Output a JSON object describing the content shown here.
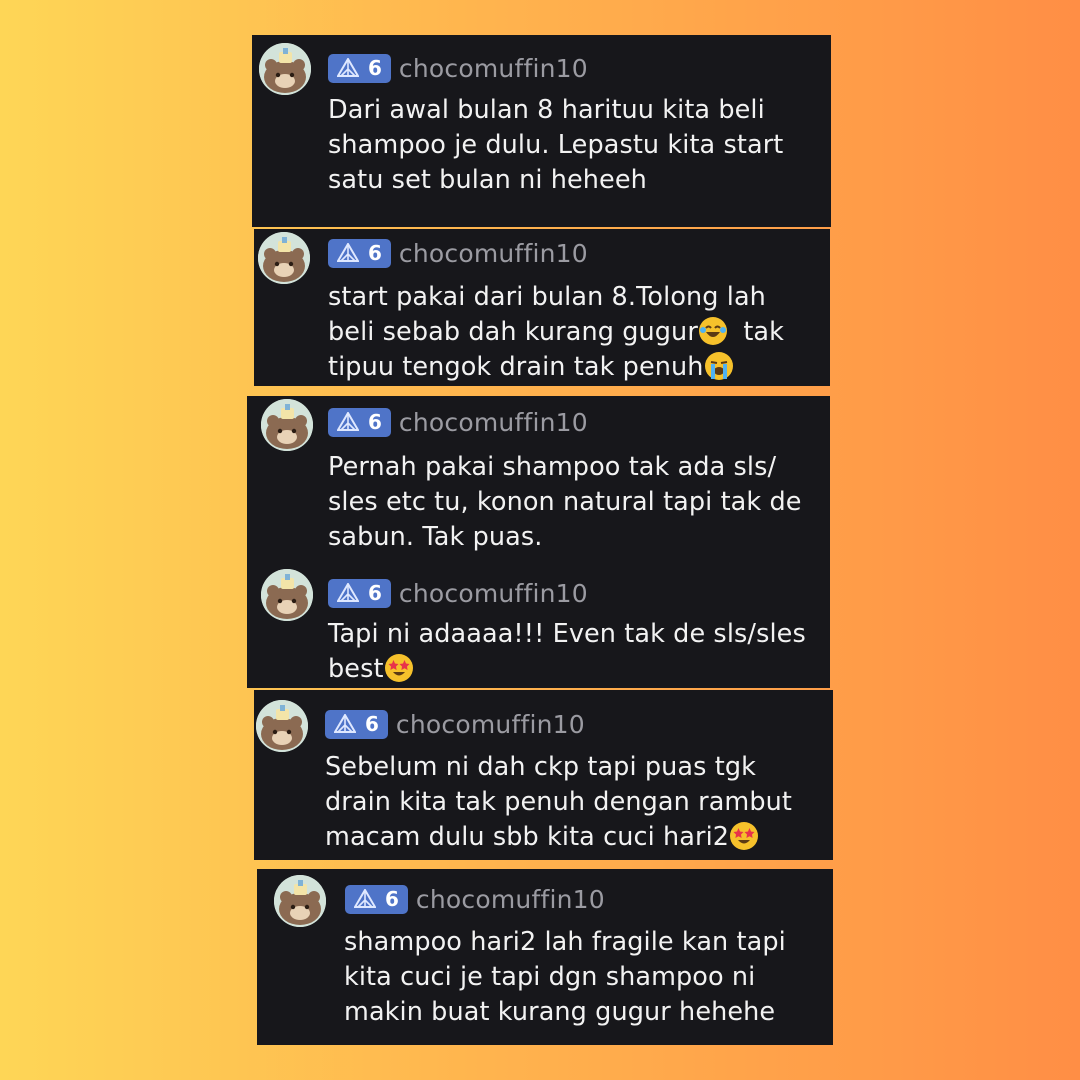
{
  "comments": [
    {
      "level": "6",
      "username": "chocomuffin10",
      "text": "Dari awal bulan 8 harituu kita beli\nshampoo je dulu. Lepastu kita start\nsatu set bulan ni heheeh"
    },
    {
      "level": "6",
      "username": "chocomuffin10",
      "text": "start pakai dari bulan 8.Tolong lah\nbeli sebab dah kurang gugur",
      "text_b": "  tak\ntipuu tengok drain tak penuh",
      "emoji_1": "laughing-crying-emoji",
      "emoji_2": "loudly-crying-emoji"
    },
    {
      "level": "6",
      "username": "chocomuffin10",
      "text": "Pernah pakai shampoo tak ada sls/\nsles etc tu, konon natural tapi tak de\nsabun. Tak puas."
    },
    {
      "level": "6",
      "username": "chocomuffin10",
      "text": "Tapi ni adaaaa!!! Even tak de sls/sles\nbest",
      "emoji_1": "star-struck-emoji"
    },
    {
      "level": "6",
      "username": "chocomuffin10",
      "text": "Sebelum ni dah ckp tapi puas tgk\ndrain kita tak penuh dengan rambut\nmacam dulu sbb kita cuci hari2",
      "emoji_1": "star-struck-emoji"
    },
    {
      "level": "6",
      "username": "chocomuffin10",
      "text": "shampoo hari2 lah fragile kan tapi\nkita cuci je tapi dgn shampoo ni\nmakin buat kurang gugur hehehe"
    }
  ],
  "colors": {
    "card_bg": "#17171b",
    "badge_bg": "#4f74c8",
    "username": "#9b9ba2",
    "text": "#f2f2f2"
  }
}
